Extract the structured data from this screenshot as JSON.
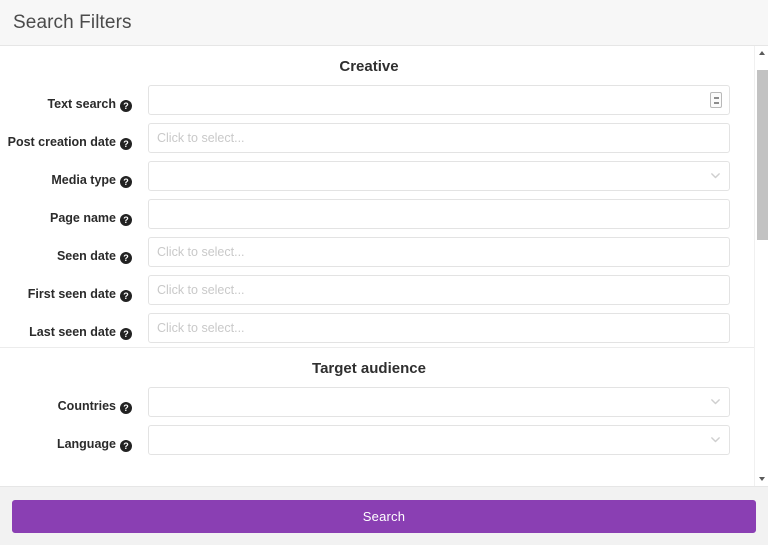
{
  "header": {
    "title": "Search Filters"
  },
  "scroll": {
    "up_arrow_icon": "triangle-up-icon",
    "down_arrow_icon": "triangle-down-icon"
  },
  "placeholders": {
    "date": "Click to select...",
    "empty": ""
  },
  "sections": [
    {
      "id": "creative",
      "title": "Creative",
      "rows": [
        {
          "id": "text-search",
          "label": "Text search",
          "help": "?",
          "control": "input-with-icon",
          "value": "",
          "placeholder": "",
          "icon": "textarea-resize-icon"
        },
        {
          "id": "post-creation-date",
          "label": "Post creation date",
          "help": "?",
          "control": "date",
          "value": "",
          "placeholder": "Click to select..."
        },
        {
          "id": "media-type",
          "label": "Media type",
          "help": "?",
          "control": "select",
          "value": "",
          "placeholder": "",
          "icon": "chevron-down-icon"
        },
        {
          "id": "page-name",
          "label": "Page name",
          "help": "?",
          "control": "input",
          "value": "",
          "placeholder": ""
        },
        {
          "id": "seen-date",
          "label": "Seen date",
          "help": "?",
          "control": "date",
          "value": "",
          "placeholder": "Click to select..."
        },
        {
          "id": "first-seen-date",
          "label": "First seen date",
          "help": "?",
          "control": "date",
          "value": "",
          "placeholder": "Click to select..."
        },
        {
          "id": "last-seen-date",
          "label": "Last seen date",
          "help": "?",
          "control": "date",
          "value": "",
          "placeholder": "Click to select..."
        }
      ]
    },
    {
      "id": "target-audience",
      "title": "Target audience",
      "rows": [
        {
          "id": "countries",
          "label": "Countries",
          "help": "?",
          "control": "select",
          "value": "",
          "placeholder": "",
          "icon": "chevron-down-icon"
        },
        {
          "id": "language",
          "label": "Language",
          "help": "?",
          "control": "select",
          "value": "",
          "placeholder": "",
          "icon": "chevron-down-icon"
        }
      ]
    }
  ],
  "footer": {
    "search_label": "Search"
  },
  "colors": {
    "accent": "#8a3fb3",
    "header_bg": "#f7f7f7",
    "footer_bg": "#f2f2f2",
    "border": "#e3e3e3",
    "placeholder": "#c9c9c9",
    "label": "#2b2b2b"
  }
}
